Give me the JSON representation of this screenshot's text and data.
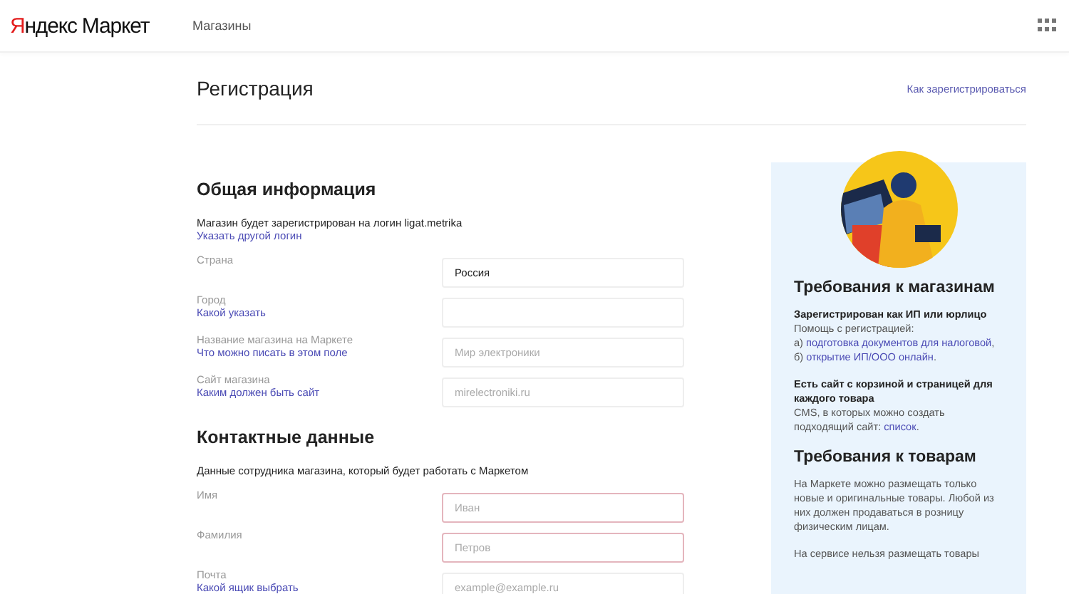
{
  "header": {
    "logo": "Яндекс Маркет",
    "nav_item": "Магазины"
  },
  "page": {
    "title": "Регистрация",
    "help_link": "Как зарегистрироваться"
  },
  "sections": [
    {
      "heading": "Общая информация",
      "intro": "Магазин будет зарегистрирован на логин ligat.metrika",
      "intro_link": "Указать другой логин",
      "fields": [
        {
          "label": "Страна",
          "value": "Россия",
          "error": false
        },
        {
          "label": "Город",
          "hint_link": "Какой указать",
          "error": false
        },
        {
          "label": "Название магазина на Маркете",
          "hint_link": "Что можно писать в этом поле",
          "placeholder": "Мир электроники",
          "error": false
        },
        {
          "label": "Сайт магазина",
          "hint_link": "Каким должен быть сайт",
          "placeholder": "mirelectroniki.ru",
          "error": false
        }
      ]
    },
    {
      "heading": "Контактные данные",
      "intro": "Данные сотрудника магазина, который будет работать с Маркетом",
      "fields": [
        {
          "label": "Имя",
          "placeholder": "Иван",
          "error": true
        },
        {
          "label": "Фамилия",
          "placeholder": "Петров",
          "error": true
        },
        {
          "label": "Почта",
          "hint_link": "Какой ящик выбрать",
          "placeholder": "example@example.ru",
          "error": false
        }
      ]
    }
  ],
  "sidebar": {
    "blocks": [
      {
        "heading": "Требования к магазинам",
        "items": [
          {
            "title": "Зарегистрирован как ИП или юрлицо",
            "lines": [
              [
                {
                  "text": "Помощь с регистрацией:",
                  "link": false
                }
              ],
              [
                {
                  "text": "а) ",
                  "link": false
                },
                {
                  "text": "подготовка документов для налоговой",
                  "link": true
                },
                {
                  "text": ",",
                  "link": false
                }
              ],
              [
                {
                  "text": "б) ",
                  "link": false
                },
                {
                  "text": "открытие ИП/ООО онлайн",
                  "link": true
                },
                {
                  "text": ".",
                  "link": false
                }
              ]
            ]
          },
          {
            "title": "Есть сайт с корзиной и страницей для каждого товара",
            "lines": [
              [
                {
                  "text": "CMS, в которых можно создать подходящий сайт: ",
                  "link": false
                },
                {
                  "text": "список",
                  "link": true
                },
                {
                  "text": ".",
                  "link": false
                }
              ]
            ]
          }
        ]
      },
      {
        "heading": "Требования к товарам",
        "items": [
          {
            "lines": [
              [
                {
                  "text": "На Маркете можно размещать только новые и оригинальные товары. Любой из них должен продаваться в розницу физическим лицам.",
                  "link": false
                }
              ]
            ]
          },
          {
            "lines": [
              [
                {
                  "text": "На сервисе нельзя размещать товары",
                  "link": false
                }
              ]
            ]
          }
        ]
      }
    ]
  }
}
